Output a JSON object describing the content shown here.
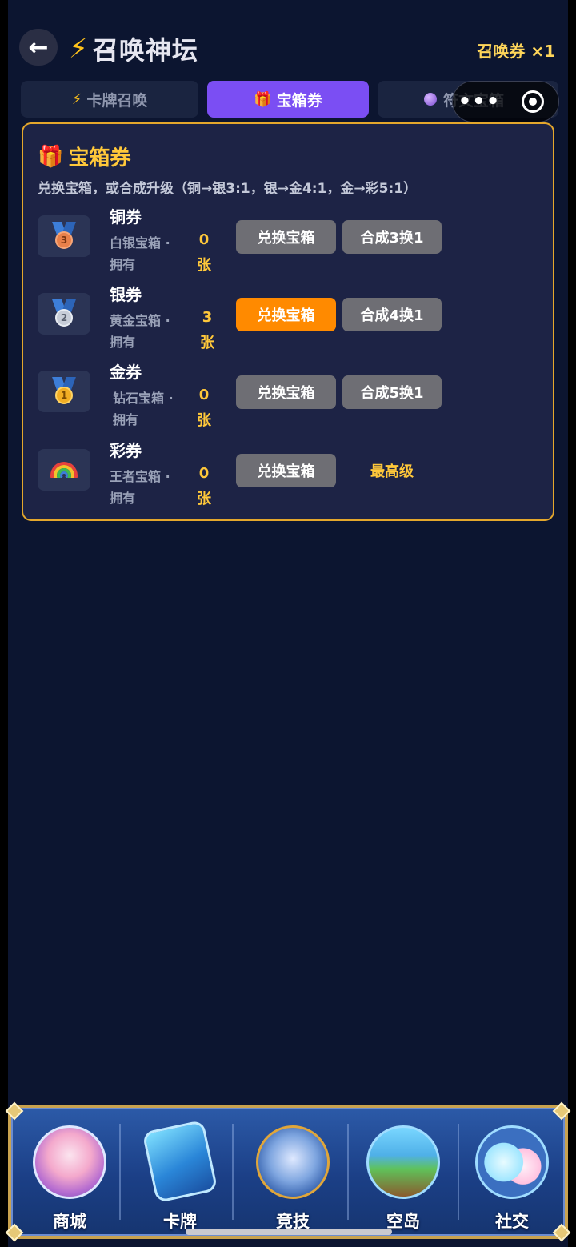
{
  "header": {
    "back_icon": "←",
    "title_icon": "⚡",
    "title": "召唤神坛",
    "ticket_count": "召唤券 ×1"
  },
  "tabs": [
    {
      "icon": "⚡",
      "label": "卡牌召唤"
    },
    {
      "icon": "🎁",
      "label": "宝箱券"
    },
    {
      "icon": "🔮",
      "label": "符文宝箱"
    }
  ],
  "capsule": {
    "more": "•••"
  },
  "panel": {
    "icon": "🎁",
    "title": "宝箱券",
    "desc": "兑换宝箱，或合成升级（铜→银3:1，银→金4:1，金→彩5:1）",
    "rows": [
      {
        "name": "铜券",
        "badge": "3",
        "box": "白银宝箱 ·",
        "own": "拥有",
        "qty": "0",
        "unit": "张",
        "exchange": "兑换宝箱",
        "merge": "合成3换1"
      },
      {
        "name": "银券",
        "badge": "2",
        "box": "黄金宝箱 ·",
        "own": "拥有",
        "qty": "3",
        "unit": "张",
        "exchange": "兑换宝箱",
        "merge": "合成4换1"
      },
      {
        "name": "金券",
        "badge": "1",
        "box": "钻石宝箱 ·",
        "own": "拥有",
        "qty": "0",
        "unit": "张",
        "exchange": "兑换宝箱",
        "merge": "合成5换1"
      },
      {
        "name": "彩券",
        "box": "王者宝箱 ·",
        "own": "拥有",
        "qty": "0",
        "unit": "张",
        "exchange": "兑换宝箱",
        "max": "最高级"
      }
    ]
  },
  "bottom_nav": [
    {
      "label": "商城",
      "icon": "shop-icon"
    },
    {
      "label": "卡牌",
      "icon": "card-icon"
    },
    {
      "label": "竞技",
      "icon": "swords-icon"
    },
    {
      "label": "空岛",
      "icon": "island-icon"
    },
    {
      "label": "社交",
      "icon": "social-icon"
    }
  ],
  "colors": {
    "background": "#0c1530",
    "accent_purple": "#7b4ef3",
    "accent_orange": "#ff8a00",
    "gold_text": "#ffc83a",
    "panel_border": "#e4a72c"
  }
}
